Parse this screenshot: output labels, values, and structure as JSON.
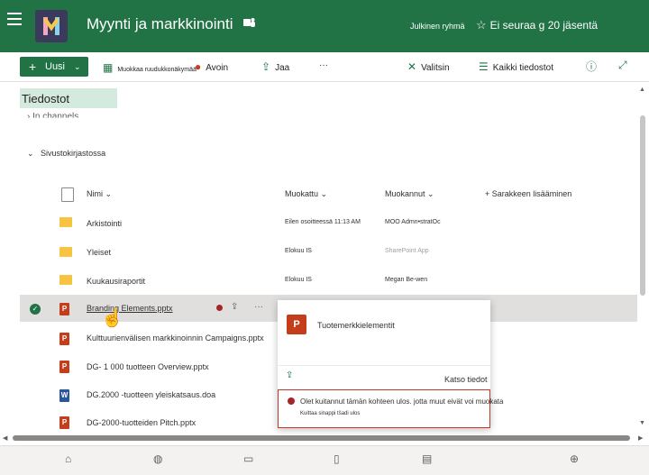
{
  "header": {
    "site_title": "Myynti ja markkinointi",
    "group_type": "Julkinen ryhmä",
    "follow_label": "Ei seuraa g 20 jäsentä"
  },
  "commandbar": {
    "new_label": "Uusi",
    "edit_grid_label": "Muokkaa ruudukkonäkymää",
    "open_label": "Avoin",
    "share_label": "Jaa",
    "more_label": "···",
    "select_label": "Valitsin",
    "all_docs_label": "Kaikki tiedostot"
  },
  "breadcrumb": {
    "current": "Tiedostot",
    "in_channels": "In channels"
  },
  "section": {
    "label": "Sivustokirjastossa"
  },
  "columns": {
    "name": "Nimi",
    "modified": "Muokattu",
    "modified_by": "Muokannut",
    "add_column": "Sarakkeen lisääminen"
  },
  "files": [
    {
      "name": "Arkistointi",
      "modified": "Eilen osoitteessä 11:13 AM",
      "modified_by": "MOO Admn•stratOc",
      "type": "folder"
    },
    {
      "name": "Yleiset",
      "modified": "Elokuu IS",
      "modified_by": "SharePoint App",
      "type": "folder"
    },
    {
      "name": "Kuukausiraportit",
      "modified": "Elokuu IS",
      "modified_by": "Megan Be-wen",
      "type": "folder"
    },
    {
      "name": "Branding Elements.pptx",
      "modified": "",
      "modified_by": "",
      "type": "ppt"
    },
    {
      "name": "Kulttuurienvälisen markkinoinnin Campaigns.pptx",
      "modified": "",
      "modified_by": "",
      "type": "ppt"
    },
    {
      "name": "DG- 1 000 tuotteen Overview.pptx",
      "modified": "",
      "modified_by": "",
      "type": "ppt"
    },
    {
      "name": "DG.2000 -tuotteen yleiskatsaus.doa",
      "modified": "",
      "modified_by": "",
      "type": "doc"
    },
    {
      "name": "DG-2000-tuotteiden Pitch.pptx",
      "modified": "",
      "modified_by": "",
      "type": "ppt"
    }
  ],
  "popup": {
    "title": "Tuotemerkkielementit",
    "see_details": "Katso tiedot",
    "warning_line1": "Olet kuitannut tämän kohteen ulos. jotta muut eivät voi muokata",
    "warning_line2": "Kuittaa sinappi tšadi ulos"
  },
  "icons": {
    "file_type": "P",
    "word_type": "W"
  },
  "colors": {
    "brand": "#217346",
    "warning": "#a4262c"
  }
}
